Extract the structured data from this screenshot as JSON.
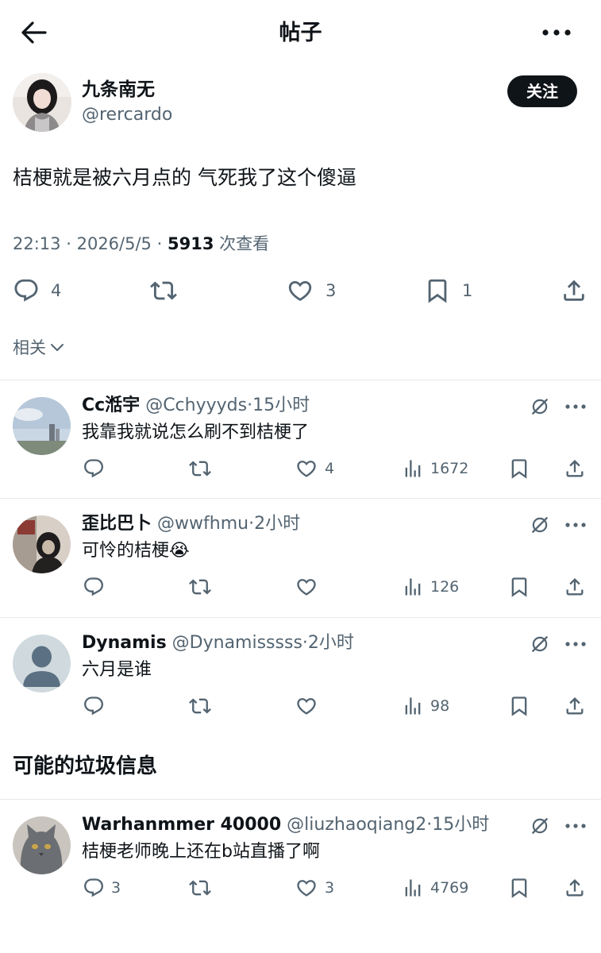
{
  "header": {
    "title": "帖子"
  },
  "main_post": {
    "author_name": "九条南无",
    "handle": "@rercardo",
    "follow_label": "关注",
    "text": "桔梗就是被六月点的 气死我了这个傻逼",
    "time": "22:13",
    "date": "2026/5/5",
    "views": "5913",
    "views_label": "次查看",
    "counts": {
      "replies": "4",
      "reposts": "",
      "likes": "3",
      "bookmarks": "1"
    }
  },
  "related": {
    "label": "相关"
  },
  "replies": [
    {
      "name": "Cc湉宇",
      "handle": "@Cchyyyds",
      "time": "15小时",
      "text": "我靠我就说怎么刷不到桔梗了",
      "reply_count": "",
      "repost_count": "",
      "like_count": "4",
      "views": "1672"
    },
    {
      "name": "歪比巴卜",
      "handle": "@wwfhmu",
      "time": "2小时",
      "text": "可怜的桔梗😭",
      "reply_count": "",
      "repost_count": "",
      "like_count": "",
      "views": "126"
    },
    {
      "name": "Dynamis",
      "handle": "@Dynamisssss",
      "time": "2小时",
      "text": "六月是谁",
      "reply_count": "",
      "repost_count": "",
      "like_count": "",
      "views": "98"
    }
  ],
  "spam_section": {
    "title": "可能的垃圾信息",
    "reply": {
      "name": "Warhanmmer 40000",
      "handle": "@liuzhaoqiang2",
      "time": "15小时",
      "text": "桔梗老师晚上还在b站直播了啊",
      "reply_count": "3",
      "repost_count": "",
      "like_count": "3",
      "views": "4769"
    }
  },
  "separator": "·",
  "colors": {
    "text": "#0f1419",
    "secondary": "#536471",
    "divider": "#e7e9ea",
    "follow_bg": "#0f1419"
  }
}
